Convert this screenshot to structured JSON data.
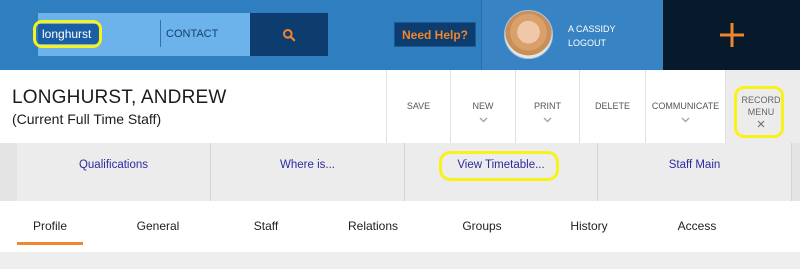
{
  "search": {
    "value": "longhurst",
    "scope": "CONTACT"
  },
  "help": {
    "label": "Need Help?"
  },
  "user": {
    "name": "A CASSIDY",
    "logout": "LOGOUT"
  },
  "record": {
    "name": "LONGHURST, ANDREW",
    "status": "(Current Full Time Staff)"
  },
  "actions": {
    "save": "SAVE",
    "new": "NEW",
    "print": "PRINT",
    "delete": "DELETE",
    "communicate": "COMMUNICATE"
  },
  "record_menu": {
    "line1": "RECORD",
    "line2": "MENU"
  },
  "quick_links": [
    "Qualifications",
    "Where is...",
    "View Timetable...",
    "Staff Main"
  ],
  "tabs": [
    "Profile",
    "General",
    "Staff",
    "Relations",
    "Groups",
    "History",
    "Access"
  ],
  "active_tab": "Profile",
  "colors": {
    "topbar": "#2f7fc0",
    "accent": "#f0862d",
    "dark": "#0d3c6e",
    "link": "#2d2aa3",
    "highlight": "#f7f21a"
  }
}
